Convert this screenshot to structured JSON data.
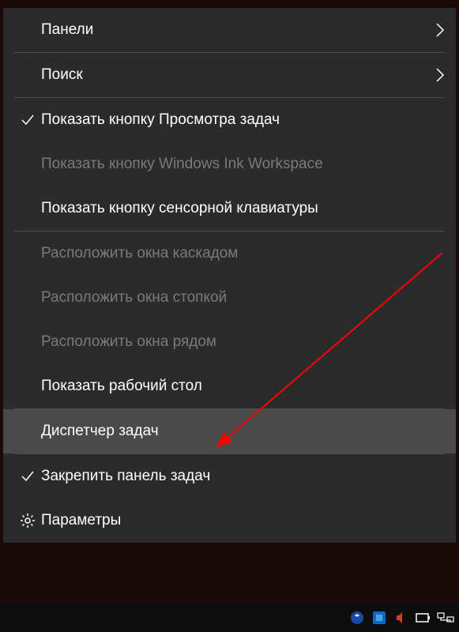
{
  "menu": {
    "items": [
      {
        "label": "Панели",
        "hasSubmenu": true
      },
      {
        "label": "Поиск",
        "hasSubmenu": true
      },
      {
        "label": "Показать кнопку Просмотра задач",
        "checked": true
      },
      {
        "label": "Показать кнопку Windows Ink Workspace",
        "disabled": true
      },
      {
        "label": "Показать кнопку сенсорной клавиатуры"
      },
      {
        "label": "Расположить окна каскадом",
        "disabled": true
      },
      {
        "label": "Расположить окна стопкой",
        "disabled": true
      },
      {
        "label": "Расположить окна рядом",
        "disabled": true
      },
      {
        "label": "Показать рабочий стол"
      },
      {
        "label": "Диспетчер задач",
        "highlighted": true
      },
      {
        "label": "Закрепить панель задач",
        "checked": true
      },
      {
        "label": "Параметры",
        "icon": "gear"
      }
    ]
  }
}
